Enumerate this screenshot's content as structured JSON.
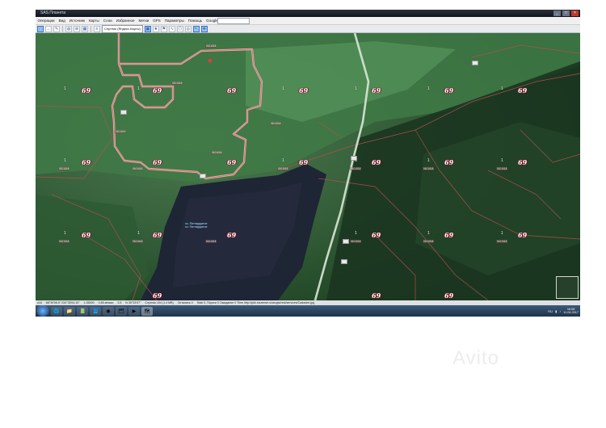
{
  "window": {
    "title": "SAS.Планета",
    "controls": [
      "_",
      "□",
      "×"
    ]
  },
  "menubar": {
    "items": [
      "Операции",
      "Вид",
      "Источник",
      "Карты",
      "Слои",
      "Избранное",
      "Метки",
      "GPS",
      "Параметры",
      "Помощь",
      "Google ▾"
    ],
    "search_placeholder": ""
  },
  "toolbar": {
    "layer_label": "Спутник (Яндекс.Карты)",
    "icons": [
      "select-icon",
      "ruler-icon",
      "edit-icon",
      "globe-icon",
      "zoom-icon",
      "grid-icon",
      "layers-icon",
      "star-icon",
      "marker-icon",
      "path-icon",
      "polygon-icon",
      "gps-icon",
      "cursor-icon",
      "move-icon"
    ]
  },
  "map": {
    "zone_label": "69",
    "sub_label": "1",
    "parcel_ids": [
      "0101018",
      "0101018",
      "0101019",
      "0101018",
      "0101018",
      "0101018",
      "0101018",
      "0101018",
      "0101018",
      "0101018",
      "0101018",
      "0101018",
      "0101018",
      "0101018",
      "0101018",
      "0101018",
      "0101018"
    ],
    "lake_label": [
      "оз. Пятнадцатое",
      "оз. Пятнадцатое"
    ],
    "colors": {
      "parcel_border": "#e8a7a7",
      "boundary_line": "#b8504f",
      "road": "#d9e7d6",
      "lake": "#1f2a3a"
    }
  },
  "statusbar": {
    "items": [
      "z16",
      "68°39'06.5\" 034°35'04.10\"",
      "1:35000",
      "0.85 м/пикс",
      "3.5",
      "N 35°33'07\"",
      "Спутник 104 (1.4 MB)",
      "Остались 0",
      "Stab 0, Пороги 0 Ожидание 0 Time http://pkk.rosreestr.ru/arcgis/rest/services/Cadastre.jpg"
    ]
  },
  "taskbar": {
    "apps": [
      "ie-icon",
      "folder-icon",
      "excel-icon",
      "word-icon",
      "chrome-icon",
      "explorer-icon",
      "media-icon",
      "sasplanet-icon"
    ],
    "active_index": 7,
    "lang": "RU",
    "time": "16:08",
    "date": "11.04.2017"
  },
  "watermark": "Avito"
}
